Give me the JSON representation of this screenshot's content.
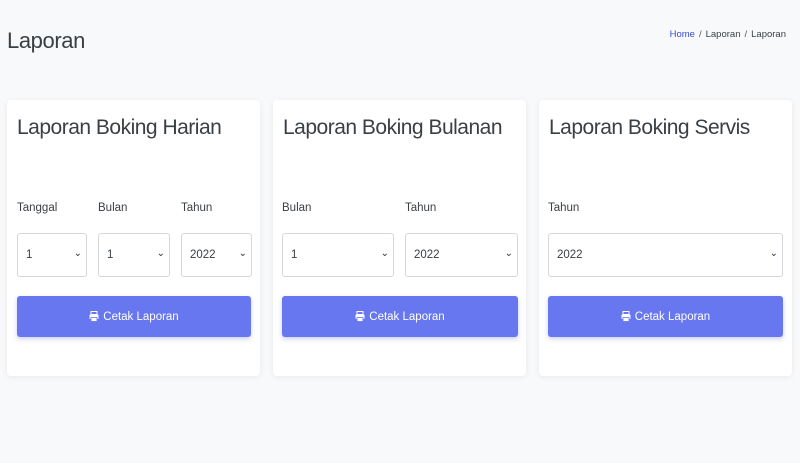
{
  "header": {
    "title": "Laporan",
    "breadcrumb": [
      {
        "label": "Home"
      },
      {
        "label": "Laporan"
      },
      {
        "label": "Laporan"
      }
    ],
    "separator": "/"
  },
  "cards": [
    {
      "title": "Laporan Boking Harian",
      "fields": [
        {
          "label": "Tanggal",
          "value": "1"
        },
        {
          "label": "Bulan",
          "value": "1"
        },
        {
          "label": "Tahun",
          "value": "2022"
        }
      ],
      "button_label": "Cetak Laporan"
    },
    {
      "title": "Laporan Boking Bulanan",
      "fields": [
        {
          "label": "Bulan",
          "value": "1"
        },
        {
          "label": "Tahun",
          "value": "2022"
        }
      ],
      "button_label": "Cetak Laporan"
    },
    {
      "title": "Laporan Boking Servis",
      "fields": [
        {
          "label": "Tahun",
          "value": "2022"
        }
      ],
      "button_label": "Cetak Laporan"
    }
  ],
  "icons": {
    "print": "print-icon",
    "dropdown": "chevron-down-icon"
  },
  "colors": {
    "accent": "#6777ef",
    "link": "#3b4bd8",
    "background": "#f8f9fa"
  }
}
